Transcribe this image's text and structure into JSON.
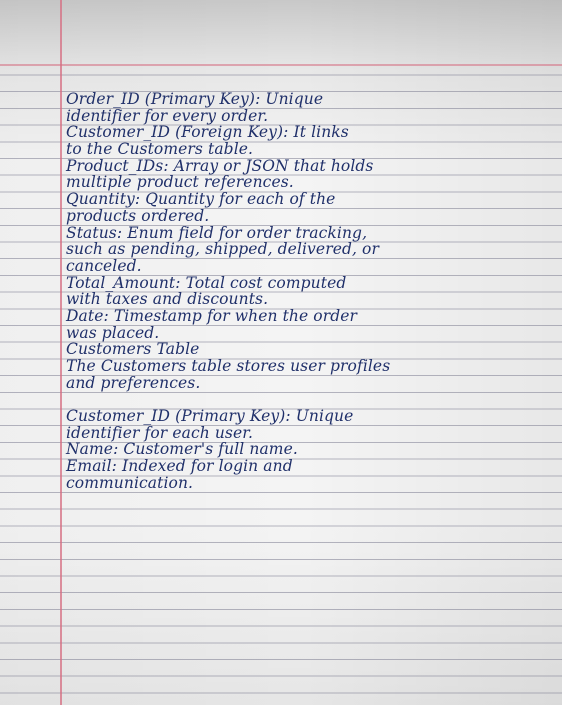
{
  "notes": {
    "lines": [
      "Order_ID (Primary Key): Unique",
      "identifier for every order.",
      "Customer_ID (Foreign Key): It links",
      "to the Customers table.",
      "Product_IDs: Array or JSON that holds",
      "multiple product references.",
      "Quantity: Quantity for each of the",
      "products ordered.",
      "Status: Enum field for order tracking,",
      "such as pending, shipped, delivered, or",
      "canceled.",
      "Total_Amount: Total cost computed",
      "with taxes and discounts.",
      "Date: Timestamp for when the order",
      "was placed.",
      "Customers Table",
      "The Customers table stores user profiles",
      "and preferences.",
      "",
      "Customer_ID (Primary Key): Unique",
      "identifier for each user.",
      "Name: Customer's full name.",
      "Email: Indexed for login and",
      "communication."
    ]
  }
}
